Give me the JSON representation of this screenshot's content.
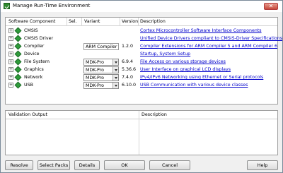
{
  "window": {
    "title": "Manage Run-Time Environment",
    "close_glyph": "✕"
  },
  "table": {
    "headers": {
      "component": "Software Component",
      "sel": "Sel.",
      "variant": "Variant",
      "version": "Version",
      "description": "Description"
    },
    "rows": [
      {
        "name": "CMSIS",
        "variant": "",
        "version": "",
        "description": "Cortex Microcontroller Software Interface Components"
      },
      {
        "name": "CMSIS Driver",
        "variant": "",
        "version": "",
        "description": "Unified Device Drivers compliant to CMSIS-Driver Specifications"
      },
      {
        "name": "Compiler",
        "variant": "ARM Compiler",
        "version": "1.2.0",
        "description": "Compiler Extensions for ARM Compiler 5 and ARM Compiler 6"
      },
      {
        "name": "Device",
        "variant": "",
        "version": "",
        "description": "Startup, System Setup"
      },
      {
        "name": "File System",
        "variant": "MDK-Pro",
        "version": "6.9.4",
        "description": "File Access on various storage devices"
      },
      {
        "name": "Graphics",
        "variant": "MDK-Pro",
        "version": "5.36.6",
        "description": "User Interface on graphical LCD displays"
      },
      {
        "name": "Network",
        "variant": "MDK-Pro",
        "version": "7.4.0",
        "description": "IPv4/IPv6 Networking using Ethernet or Serial protocols"
      },
      {
        "name": "USB",
        "variant": "MDK-Pro",
        "version": "6.10.0",
        "description": "USB Communication with various device classes"
      }
    ]
  },
  "validation": {
    "output_header": "Validation Output",
    "description_header": "Description"
  },
  "buttons": {
    "resolve": "Resolve",
    "select_packs": "Select Packs",
    "details": "Details",
    "ok": "OK",
    "cancel": "Cancel",
    "help": "Help"
  },
  "icons": {
    "expand": "+"
  },
  "colors": {
    "link": "#0000cc",
    "component_gem": "#2e9b3a"
  }
}
